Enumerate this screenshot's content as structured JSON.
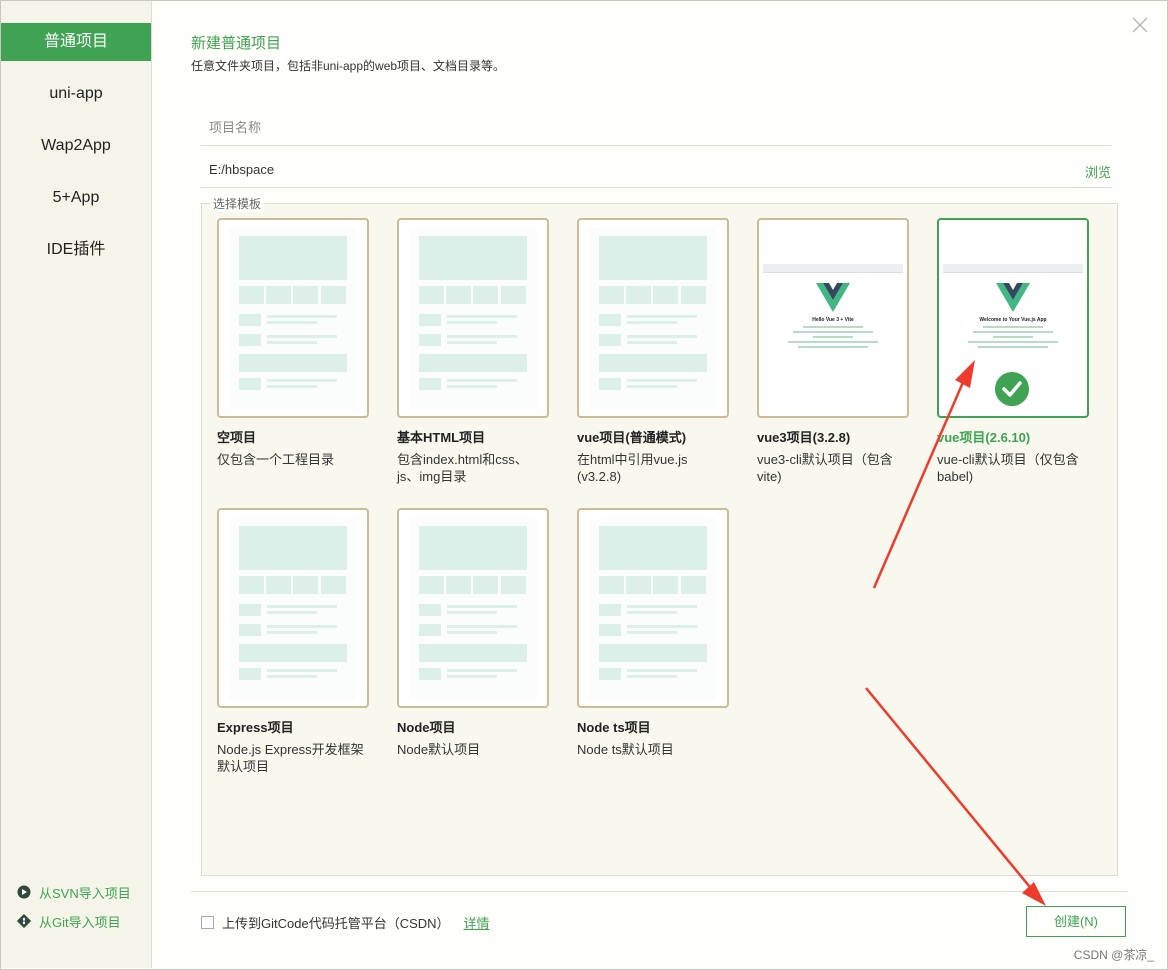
{
  "sidebar": {
    "items": [
      {
        "label": "普通项目",
        "active": true
      },
      {
        "label": "uni-app",
        "active": false
      },
      {
        "label": "Wap2App",
        "active": false
      },
      {
        "label": "5+App",
        "active": false
      },
      {
        "label": "IDE插件",
        "active": false
      }
    ],
    "import_svn": "从SVN导入项目",
    "import_git": "从Git导入项目"
  },
  "header": {
    "title": "新建普通项目",
    "subtitle": "任意文件夹项目，包括非uni-app的web项目、文档目录等。"
  },
  "form": {
    "name_placeholder": "项目名称",
    "name_value": "",
    "path_value": "E:/hbspace",
    "browse_label": "浏览",
    "template_legend": "选择模板"
  },
  "templates": [
    {
      "name": "空项目",
      "desc": "仅包含一个工程目录",
      "preview": "doc",
      "selected": false
    },
    {
      "name": "基本HTML项目",
      "desc": "包含index.html和css、js、img目录",
      "preview": "doc",
      "selected": false
    },
    {
      "name": "vue项目(普通模式)",
      "desc": "在html中引用vue.js (v3.2.8)",
      "preview": "doc",
      "selected": false
    },
    {
      "name": "vue3项目(3.2.8)",
      "desc": "vue3-cli默认项目（包含vite)",
      "preview": "vue3",
      "preview_title": "Hello Vue 3 + Vite",
      "selected": false
    },
    {
      "name": "vue项目(2.6.10)",
      "desc": "vue-cli默认项目（仅包含babel)",
      "preview": "vue2",
      "preview_title": "Welcome to Your Vue.js App",
      "selected": true
    },
    {
      "name": "Express项目",
      "desc": "Node.js Express开发框架默认项目",
      "preview": "doc",
      "selected": false
    },
    {
      "name": "Node项目",
      "desc": "Node默认项目",
      "preview": "doc",
      "selected": false
    },
    {
      "name": "Node ts项目",
      "desc": "Node ts默认项目",
      "preview": "doc",
      "selected": false
    }
  ],
  "footer": {
    "upload_label": "上传到GitCode代码托管平台（CSDN）",
    "upload_checked": false,
    "detail_label": "详情",
    "create_label": "创建(N)"
  },
  "watermark": "CSDN @茶凉_",
  "colors": {
    "accent": "#3fa353",
    "sidebar_bg": "#f5f4e8",
    "card_border": "#c8bd95",
    "annotation_arrow": "#ef3b2d"
  }
}
